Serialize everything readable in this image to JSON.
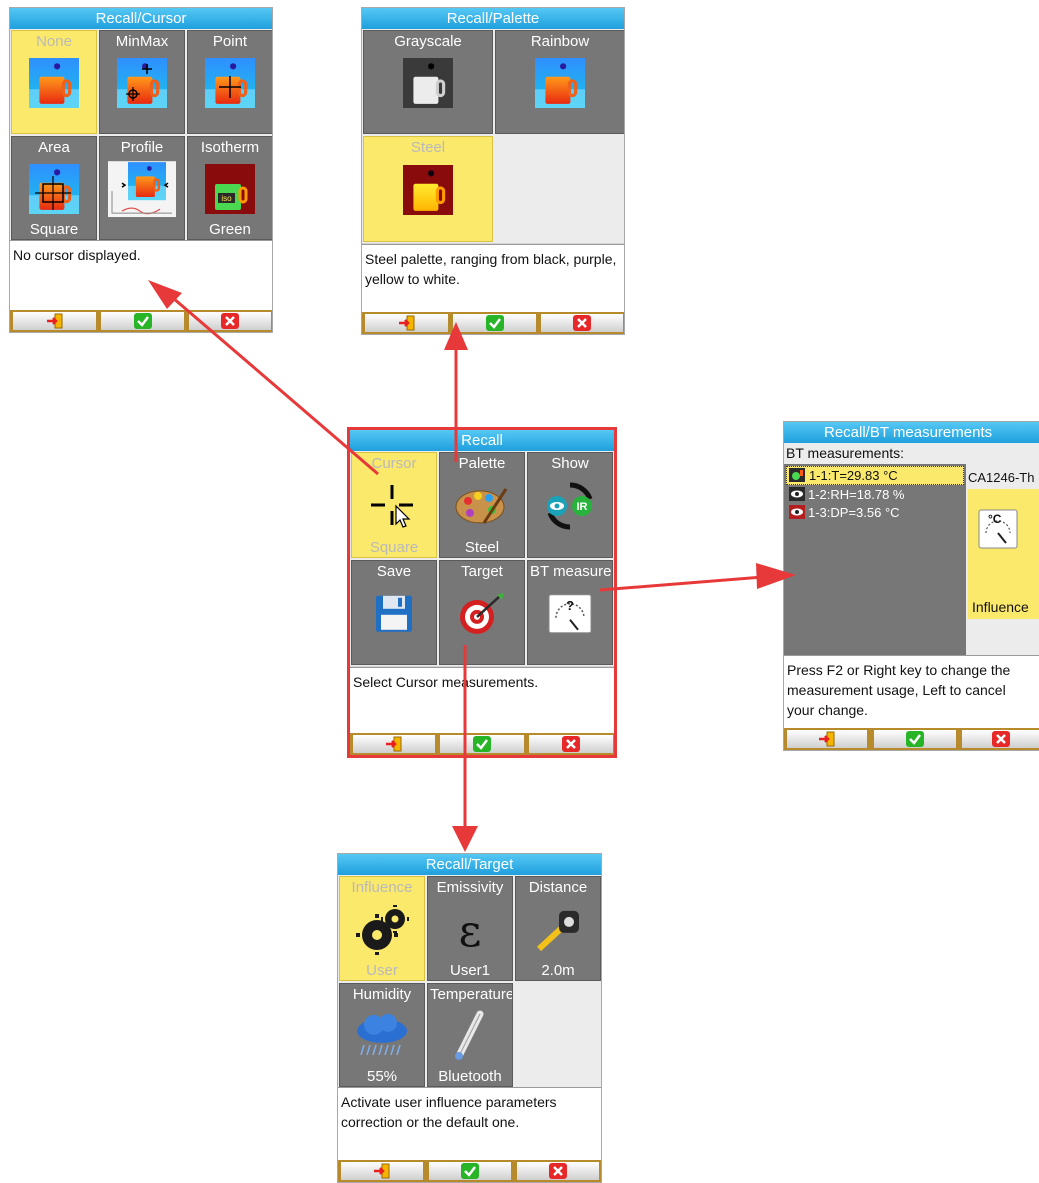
{
  "screens": {
    "cursor": {
      "title": "Recall/Cursor",
      "tiles": [
        {
          "label": "None",
          "value": "",
          "icon": "thermal-cup-icon",
          "selected": true
        },
        {
          "label": "MinMax",
          "value": "",
          "icon": "minmax-cursor-icon"
        },
        {
          "label": "Point",
          "value": "",
          "icon": "point-cursor-icon"
        },
        {
          "label": "Area",
          "value": "Square",
          "icon": "area-cursor-icon"
        },
        {
          "label": "Profile",
          "value": "",
          "icon": "profile-cursor-icon"
        },
        {
          "label": "Isotherm",
          "value": "Green",
          "icon": "isotherm-icon"
        }
      ],
      "description": "No cursor displayed."
    },
    "palette": {
      "title": "Recall/Palette",
      "tiles": [
        {
          "label": "Grayscale",
          "value": "",
          "icon": "grayscale-cup-icon"
        },
        {
          "label": "Rainbow",
          "value": "",
          "icon": "rainbow-cup-icon"
        },
        {
          "label": "Steel",
          "value": "",
          "icon": "steel-cup-icon",
          "selected": true
        }
      ],
      "description": "Steel palette, ranging from black, purple, yellow to white."
    },
    "recall": {
      "title": "Recall",
      "tiles": [
        {
          "label": "Cursor",
          "value": "Square",
          "icon": "crosshair-cursor-icon",
          "selected": true
        },
        {
          "label": "Palette",
          "value": "Steel",
          "icon": "paint-palette-icon"
        },
        {
          "label": "Show",
          "value": "",
          "icon": "eye-ir-toggle-icon"
        },
        {
          "label": "Save",
          "value": "",
          "icon": "floppy-disk-icon"
        },
        {
          "label": "Target",
          "value": "",
          "icon": "target-dart-icon"
        },
        {
          "label": "BT measure",
          "value": "",
          "icon": "gauge-question-icon"
        }
      ],
      "description": "Select Cursor measurements."
    },
    "bt": {
      "title": "Recall/BT measurements",
      "header": "BT measurements:",
      "items": [
        {
          "text": "1-1:T=29.83 °C",
          "icon": "thermo-sensor-icon",
          "selected": true
        },
        {
          "text": "1-2:RH=18.78 %",
          "icon": "eye-sensor-icon"
        },
        {
          "text": "1-3:DP=3.56 °C",
          "icon": "eye-sensor-red-icon"
        }
      ],
      "device": "CA1246-Th",
      "unit": "°C",
      "usage": "Influence",
      "description": "Press F2 or Right key to change the measurement usage, Left to cancel your change."
    },
    "target": {
      "title": "Recall/Target",
      "tiles": [
        {
          "label": "Influence",
          "value": "User",
          "icon": "gears-icon",
          "selected": true
        },
        {
          "label": "Emissivity",
          "value": "User1",
          "icon": "epsilon-icon"
        },
        {
          "label": "Distance",
          "value": "2.0m",
          "icon": "tape-measure-icon"
        },
        {
          "label": "Humidity",
          "value": "55%",
          "icon": "rain-cloud-icon"
        },
        {
          "label": "Temperature",
          "value": "Bluetooth",
          "icon": "thermometer-icon"
        }
      ],
      "description": "Activate user influence parameters correction or the default one."
    }
  },
  "colors": {
    "title_bar": "#1f9fdd",
    "selected_tile": "#fbe96c",
    "tile": "#777777",
    "arrow": "#e8393a",
    "function_bar": "#b78a2c"
  }
}
